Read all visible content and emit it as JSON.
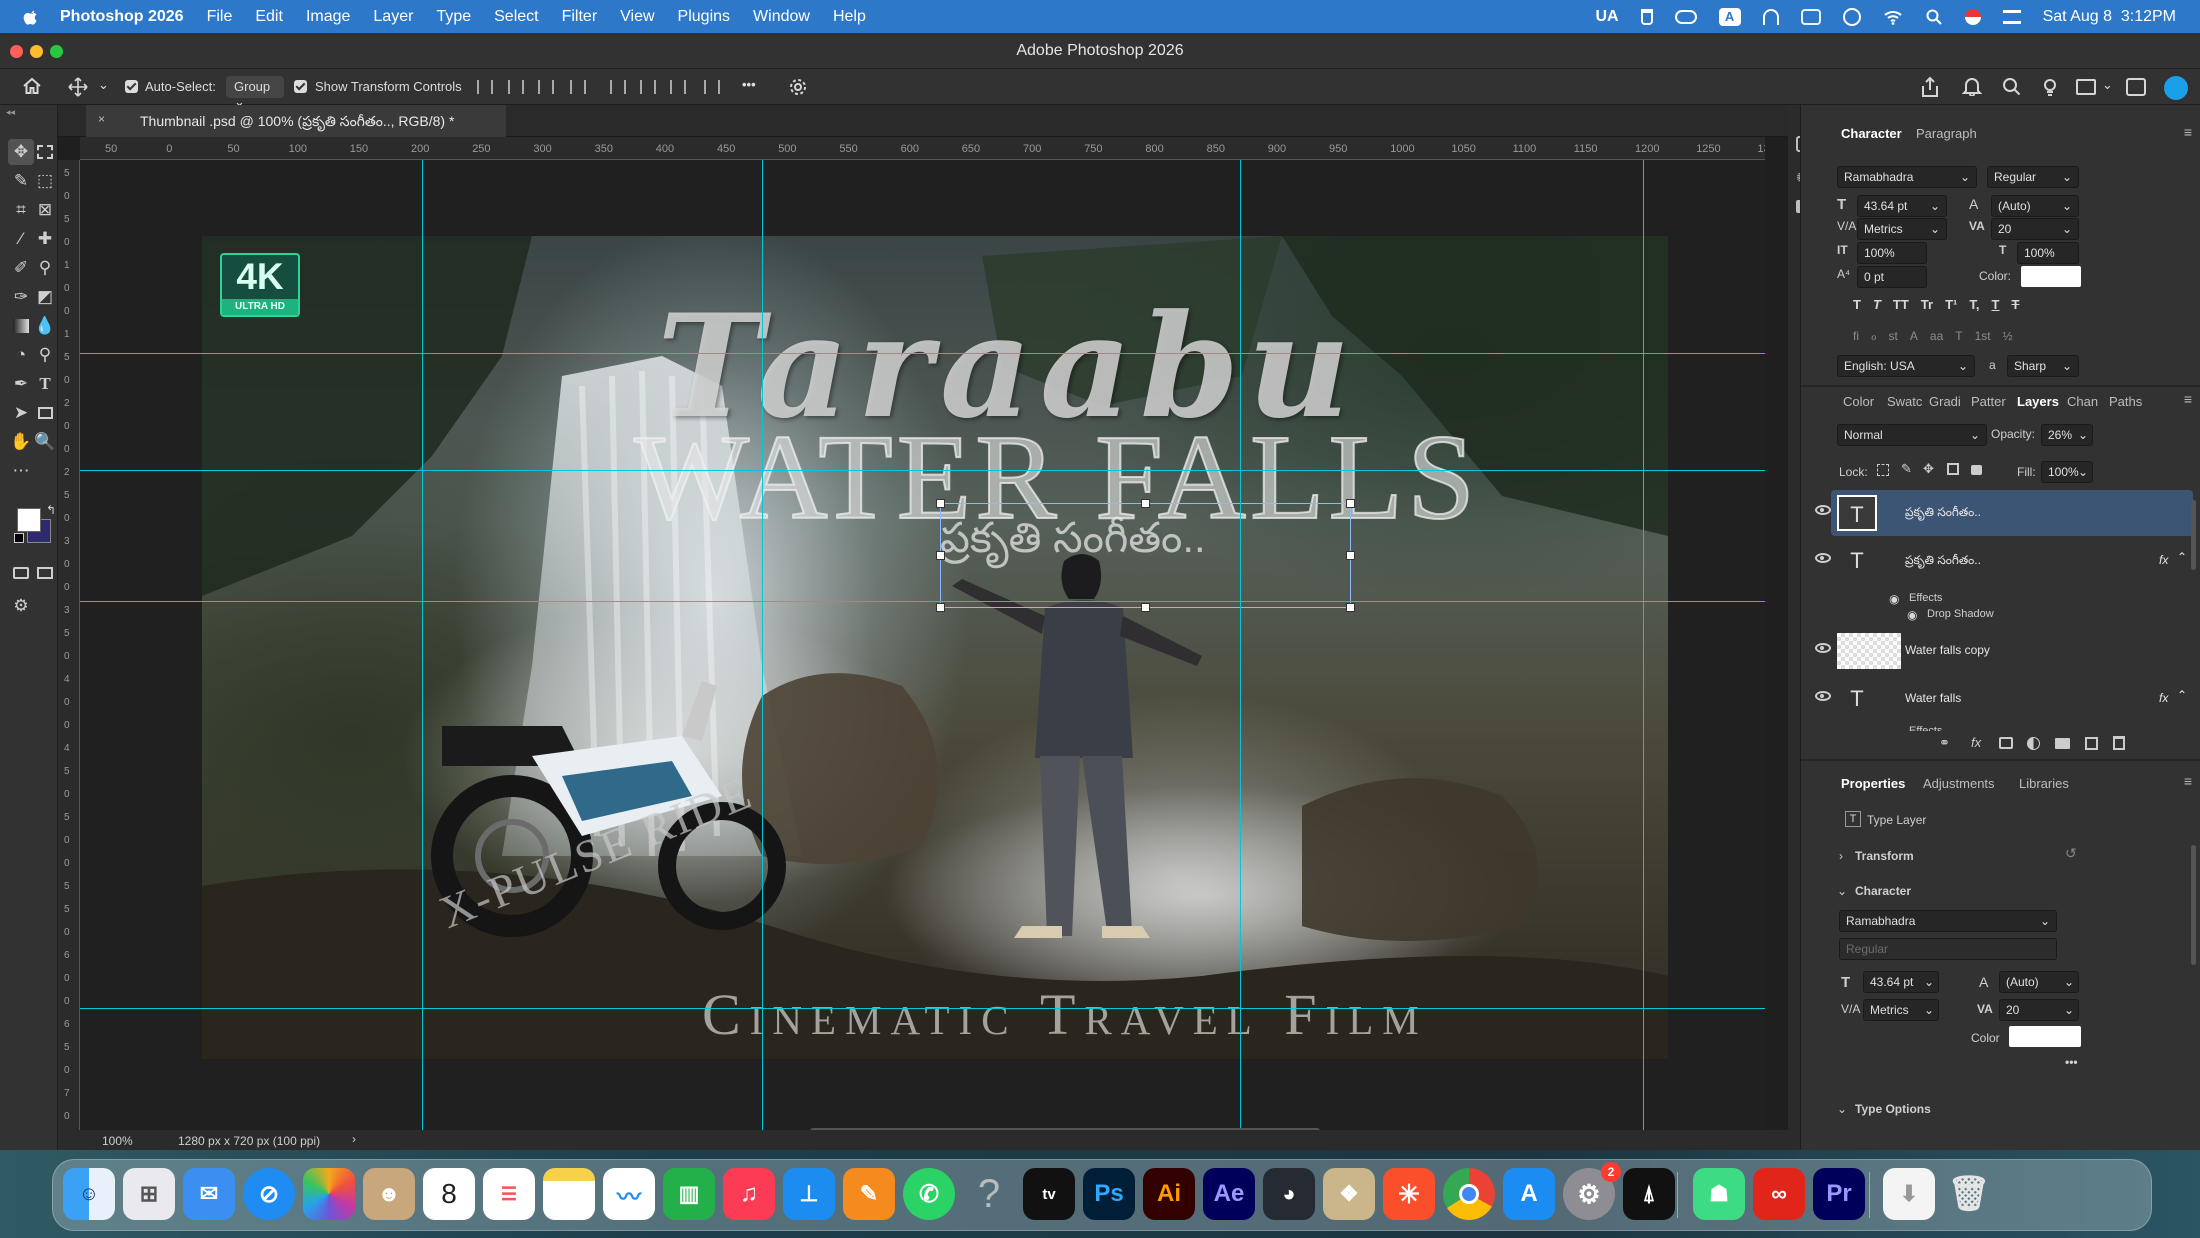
{
  "menubar": {
    "app_name": "Photoshop 2026",
    "items": [
      "File",
      "Edit",
      "Image",
      "Layer",
      "Type",
      "Select",
      "Filter",
      "View",
      "Plugins",
      "Window",
      "Help"
    ],
    "input_lang": "UA",
    "datetime": "Sat Aug 8  3:12PM"
  },
  "window": {
    "title": "Adobe Photoshop 2026"
  },
  "options_bar": {
    "auto_select_label": "Auto-Select:",
    "auto_select_value": "Group",
    "transform_label": "Show Transform Controls",
    "more": "•••"
  },
  "document": {
    "tab_title": "Thumbnail .psd @ 100% (ప్రకృతి సంగీతం.., RGB/8) *",
    "zoom": "100%",
    "doc_info": "1280 px x 720 px (100 ppi)"
  },
  "ruler": {
    "top_ticks": [
      "50",
      "0",
      "50",
      "100",
      "150",
      "200",
      "250",
      "300",
      "350",
      "400",
      "450",
      "500",
      "550",
      "600",
      "650",
      "700",
      "750",
      "800",
      "850",
      "900",
      "950",
      "1000",
      "1050",
      "1100",
      "1150",
      "1200",
      "1250",
      "130"
    ],
    "left_ticks": [
      "5",
      "0",
      "5",
      "0",
      "1",
      "0",
      "0",
      "1",
      "5",
      "0",
      "2",
      "0",
      "0",
      "2",
      "5",
      "0",
      "3",
      "0",
      "0",
      "3",
      "5",
      "0",
      "4",
      "0",
      "0",
      "4",
      "5",
      "0",
      "5",
      "0",
      "0",
      "5",
      "5",
      "0",
      "6",
      "0",
      "0",
      "6",
      "5",
      "0",
      "7",
      "0"
    ]
  },
  "artwork": {
    "badge_main": "4K",
    "badge_sub": "ULTRA HD",
    "title_script": "Taraabu",
    "title_big": "WATER FALLS",
    "telugu": "ప్రకృతి సంగీతం..",
    "curve_text": "X-PULSE RIDE",
    "bottom_text": "Cinematic Travel Film"
  },
  "character_panel": {
    "tabs": [
      "Character",
      "Paragraph"
    ],
    "font_family": "Ramabhadra",
    "font_style": "Regular",
    "size": "43.64 pt",
    "leading": "(Auto)",
    "kerning": "Metrics",
    "tracking": "20",
    "vscale": "100%",
    "hscale": "100%",
    "baseline": "0 pt",
    "color_label": "Color:",
    "style_buttons": [
      "T",
      "T",
      "TT",
      "Tr",
      "T¹",
      "T,",
      "T",
      "T"
    ],
    "opentype_buttons": [
      "fi",
      "ℴ",
      "st",
      "A",
      "aa",
      "T",
      "1st",
      "½"
    ],
    "language": "English: USA",
    "aa": "a",
    "antialias": "Sharp",
    "color": "#ffffff"
  },
  "layers_panel": {
    "tabs": [
      "Color",
      "Swatc",
      "Gradi",
      "Patter",
      "Layers",
      "Chan",
      "Paths"
    ],
    "blend_mode": "Normal",
    "opacity_label": "Opacity:",
    "opacity": "26%",
    "lock_label": "Lock:",
    "fill_label": "Fill:",
    "fill": "100%",
    "layers": [
      {
        "name": "ప్రకృతి సంగీతం..",
        "type": "T",
        "selected": true
      },
      {
        "name": "ప్రకృతి సంగీతం..",
        "type": "T",
        "fx": "fx"
      },
      {
        "name": "Water falls copy",
        "type": "raster"
      },
      {
        "name": "Water falls",
        "type": "T",
        "fx": "fx"
      }
    ],
    "effects_label": "Effects",
    "drop_shadow": "Drop Shadow",
    "effects_label_2": "Effects"
  },
  "properties_panel": {
    "tabs": [
      "Properties",
      "Adjustments",
      "Libraries"
    ],
    "layer_kind": "Type Layer",
    "transform": "Transform",
    "character": "Character",
    "font_family": "Ramabhadra",
    "font_style": "Regular",
    "size": "43.64 pt",
    "leading": "(Auto)",
    "kerning": "Metrics",
    "tracking": "20",
    "color_label": "Color",
    "more": "•••",
    "type_options": "Type Options"
  },
  "dock": {
    "apps": [
      "Finder",
      "Launchpad",
      "Mail",
      "Safari",
      "Photos",
      "Contacts",
      "Calendar",
      "Reminders",
      "Notes",
      "Freeform",
      "Numbers",
      "Music",
      "Keynote",
      "Pages",
      "WhatsApp",
      "Help",
      "TV",
      "Ps",
      "Ai",
      "Ae",
      "DaVinci Resolve",
      "Preview",
      "Toolbox",
      "Chrome",
      "App Store",
      "System Settings",
      "CapCut",
      "Android Studio",
      "Creative Cloud",
      "Pr",
      "Downloads",
      "Trash"
    ],
    "calendar_day": "8",
    "settings_badge": "2",
    "ps_label": "Ps",
    "ai_label": "Ai",
    "ae_label": "Ae",
    "pr_label": "Pr"
  }
}
